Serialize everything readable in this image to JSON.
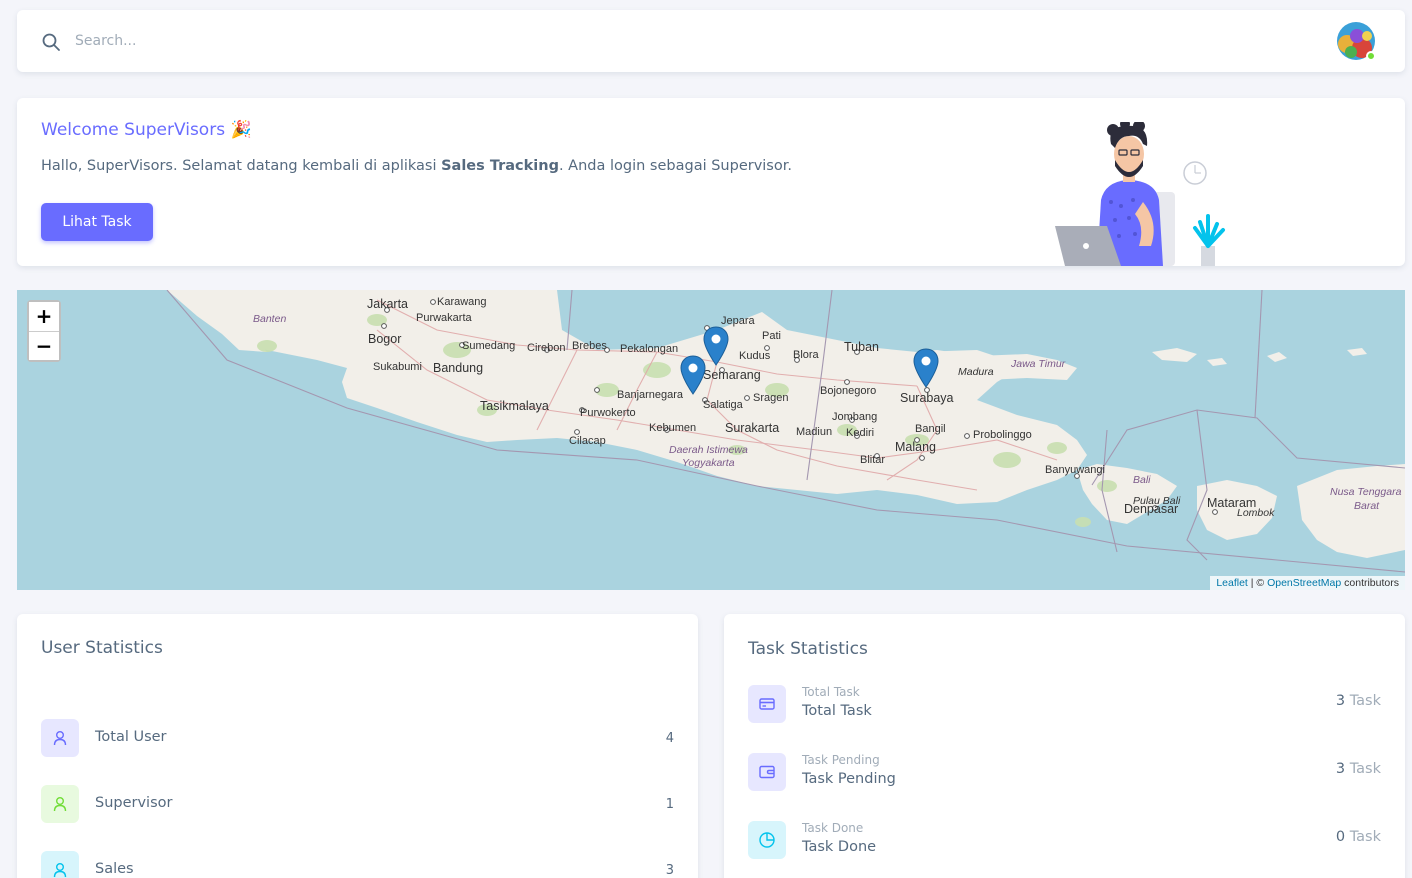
{
  "navbar": {
    "search_placeholder": "Search...",
    "search_icon": "search-icon",
    "avatar_status_color": "#71dd37"
  },
  "welcome": {
    "title": "Welcome SuperVisors 🎉",
    "text_before": "Hallo, SuperVisors. Selamat datang kembali di aplikasi ",
    "text_bold": "Sales Tracking",
    "text_after": ". Anda login sebagai Supervisor.",
    "button_label": "Lihat Task",
    "accent_color": "#696cff"
  },
  "map": {
    "zoom_in": "+",
    "zoom_out": "−",
    "attribution": {
      "leaflet": "Leaflet",
      "separator": " | © ",
      "osm": "OpenStreetMap",
      "suffix": " contributors"
    },
    "places": [
      "Jakarta",
      "Karawang",
      "Banten",
      "Purwakarta",
      "Bogor",
      "Sumedang",
      "Cirebon",
      "Brebes",
      "Pekalongan",
      "Jepara",
      "Pati",
      "Kudus",
      "Blora",
      "Tuban",
      "Madura",
      "Jawa Timur",
      "Sukabumi",
      "Bandung",
      "Semarang",
      "Banjarnegara",
      "Salatiga",
      "Sragen",
      "Bojonegoro",
      "Surabaya",
      "Tasikmalaya",
      "Purwokerto",
      "Jombang",
      "Cilacap",
      "Kebumen",
      "Surakarta",
      "Madiun",
      "Kediri",
      "Bangil",
      "Probolinggo",
      "Daerah Istimewa",
      "Yogyakarta",
      "Malang",
      "Blitar",
      "Banyuwangi",
      "Bali",
      "Pulau Bali",
      "Denpasar",
      "Mataram",
      "Lombok",
      "Nusa Tenggara",
      "Barat"
    ],
    "marker_count": 3
  },
  "user_stats": {
    "title": "User Statistics",
    "items": [
      {
        "label": "Total User",
        "value": "4",
        "icon": "user-icon",
        "color": "#696cff",
        "bg": "#e7e7ff"
      },
      {
        "label": "Supervisor",
        "value": "1",
        "icon": "user-icon",
        "color": "#71dd37",
        "bg": "#e8fadf"
      },
      {
        "label": "Sales",
        "value": "3",
        "icon": "user-icon",
        "color": "#03c3ec",
        "bg": "#d7f5fc"
      }
    ]
  },
  "task_stats": {
    "title": "Task Statistics",
    "items": [
      {
        "sub": "Total Task",
        "label": "Total Task",
        "value": "3",
        "unit": " Task",
        "icon": "credit-card-icon",
        "color": "#696cff",
        "bg": "#e7e7ff"
      },
      {
        "sub": "Task Pending",
        "label": "Task Pending",
        "value": "3",
        "unit": " Task",
        "icon": "wallet-icon",
        "color": "#696cff",
        "bg": "#e7e7ff"
      },
      {
        "sub": "Task Done",
        "label": "Task Done",
        "value": "0",
        "unit": " Task",
        "icon": "pie-chart-icon",
        "color": "#03c3ec",
        "bg": "#d7f5fc"
      }
    ]
  }
}
